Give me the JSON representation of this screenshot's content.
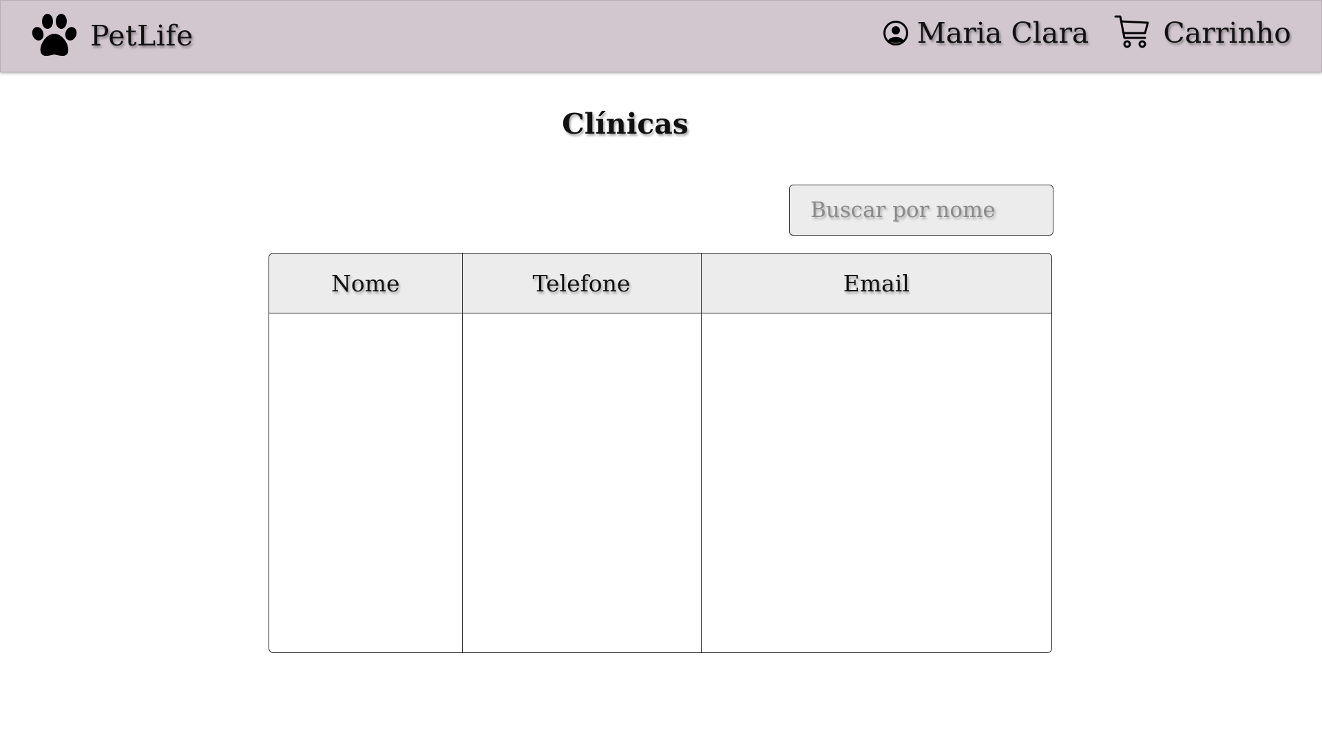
{
  "navbar": {
    "brand": "PetLife",
    "user_name": "Maria Clara",
    "cart_label": "Carrinho",
    "background": "#d2c6cf",
    "icons": {
      "brand": "paw-icon",
      "user": "user-circle-icon",
      "cart": "cart-icon"
    }
  },
  "page": {
    "title": "Clínicas"
  },
  "search": {
    "placeholder": "Buscar por nome",
    "value": ""
  },
  "table": {
    "columns": [
      "Nome",
      "Telefone",
      "Email"
    ],
    "rows": []
  }
}
